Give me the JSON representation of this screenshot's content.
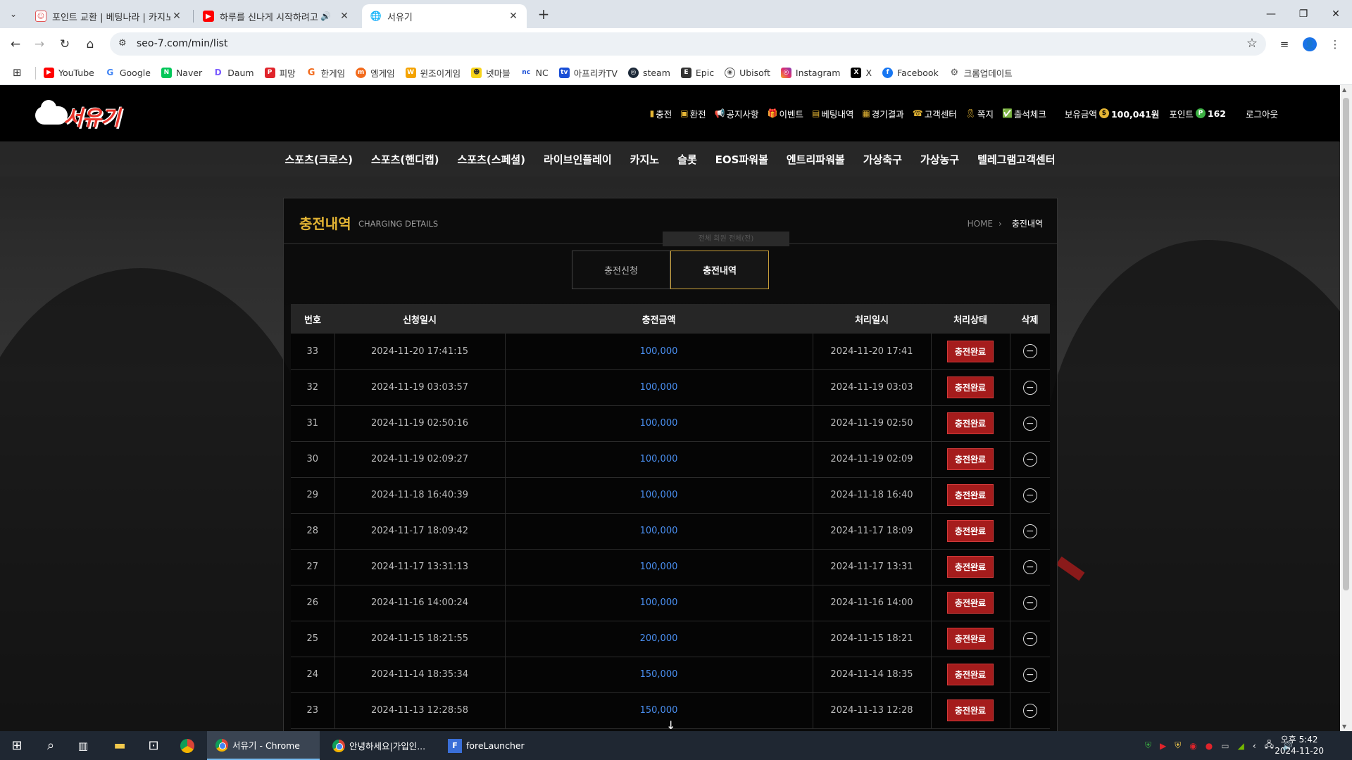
{
  "browser": {
    "tabs": [
      {
        "title": "포인트 교환 | 베팅나라 | 카지노",
        "active": false
      },
      {
        "title": "하루를 신나게 시작하려고",
        "active": false
      },
      {
        "title": "서유기",
        "active": true
      }
    ],
    "url": "seo-7.com/min/list",
    "bookmarks": [
      "YouTube",
      "Google",
      "Naver",
      "Daum",
      "피망",
      "한게임",
      "엠게임",
      "윈조이게임",
      "넷마블",
      "NC",
      "아프리카TV",
      "steam",
      "Epic",
      "Ubisoft",
      "Instagram",
      "X",
      "Facebook",
      "크롬업데이트"
    ]
  },
  "site": {
    "logo_text": "서유기",
    "topnav": [
      {
        "label": "충전",
        "icon": "wallet-icon"
      },
      {
        "label": "환전",
        "icon": "exchange-icon"
      },
      {
        "label": "공지사항",
        "icon": "megaphone-icon"
      },
      {
        "label": "이벤트",
        "icon": "gift-icon"
      },
      {
        "label": "베팅내역",
        "icon": "receipt-icon"
      },
      {
        "label": "경기결과",
        "icon": "clipboard-icon"
      },
      {
        "label": "고객센터",
        "icon": "headset-icon"
      },
      {
        "label": "쪽지",
        "icon": "ribbon-icon"
      },
      {
        "label": "출석체크",
        "icon": "calendar-check-icon"
      }
    ],
    "balance_label": "보유금액",
    "balance_value": "100,041원",
    "points_label": "포인트",
    "points_value": "162",
    "logout_label": "로그아웃",
    "mainnav": [
      "스포츠(크로스)",
      "스포츠(핸디캡)",
      "스포츠(스페셜)",
      "라이브인플레이",
      "카지노",
      "슬롯",
      "EOS파워볼",
      "엔트리파워볼",
      "가상축구",
      "가상농구",
      "텔레그램고객센터"
    ]
  },
  "panel": {
    "title": "충전내역",
    "subtitle": "CHARGING DETAILS",
    "breadcrumb_home": "HOME",
    "breadcrumb_current": "충전내역",
    "ghost_text": "전체 회원 전체(전)",
    "tabs": [
      "충전신청",
      "충전내역"
    ],
    "active_tab": 1,
    "columns": [
      "번호",
      "신청일시",
      "충전금액",
      "처리일시",
      "처리상태",
      "삭제"
    ],
    "rows": [
      {
        "no": "33",
        "requested": "2024-11-20 17:41:15",
        "amount": "100,000",
        "processed": "2024-11-20 17:41",
        "status": "충전완료"
      },
      {
        "no": "32",
        "requested": "2024-11-19 03:03:57",
        "amount": "100,000",
        "processed": "2024-11-19 03:03",
        "status": "충전완료"
      },
      {
        "no": "31",
        "requested": "2024-11-19 02:50:16",
        "amount": "100,000",
        "processed": "2024-11-19 02:50",
        "status": "충전완료"
      },
      {
        "no": "30",
        "requested": "2024-11-19 02:09:27",
        "amount": "100,000",
        "processed": "2024-11-19 02:09",
        "status": "충전완료"
      },
      {
        "no": "29",
        "requested": "2024-11-18 16:40:39",
        "amount": "100,000",
        "processed": "2024-11-18 16:40",
        "status": "충전완료"
      },
      {
        "no": "28",
        "requested": "2024-11-17 18:09:42",
        "amount": "100,000",
        "processed": "2024-11-17 18:09",
        "status": "충전완료"
      },
      {
        "no": "27",
        "requested": "2024-11-17 13:31:13",
        "amount": "100,000",
        "processed": "2024-11-17 13:31",
        "status": "충전완료"
      },
      {
        "no": "26",
        "requested": "2024-11-16 14:00:24",
        "amount": "100,000",
        "processed": "2024-11-16 14:00",
        "status": "충전완료"
      },
      {
        "no": "25",
        "requested": "2024-11-15 18:21:55",
        "amount": "200,000",
        "processed": "2024-11-15 18:21",
        "status": "충전완료"
      },
      {
        "no": "24",
        "requested": "2024-11-14 18:35:34",
        "amount": "150,000",
        "processed": "2024-11-14 18:35",
        "status": "충전완료"
      },
      {
        "no": "23",
        "requested": "2024-11-13 12:28:58",
        "amount": "150,000",
        "processed": "2024-11-13 12:28",
        "status": "충전완료"
      }
    ]
  },
  "taskbar": {
    "apps": [
      {
        "label": "서유기 - Chrome",
        "active": true
      },
      {
        "label": "안녕하세요|가입인...",
        "active": false
      },
      {
        "label": "foreLauncher",
        "active": false
      }
    ],
    "time": "오후 5:42",
    "date": "2024-11-20"
  },
  "colors": {
    "accent_gold": "#e4b534",
    "status_red": "#a51c1c",
    "amount_blue": "#4a8ff0"
  }
}
